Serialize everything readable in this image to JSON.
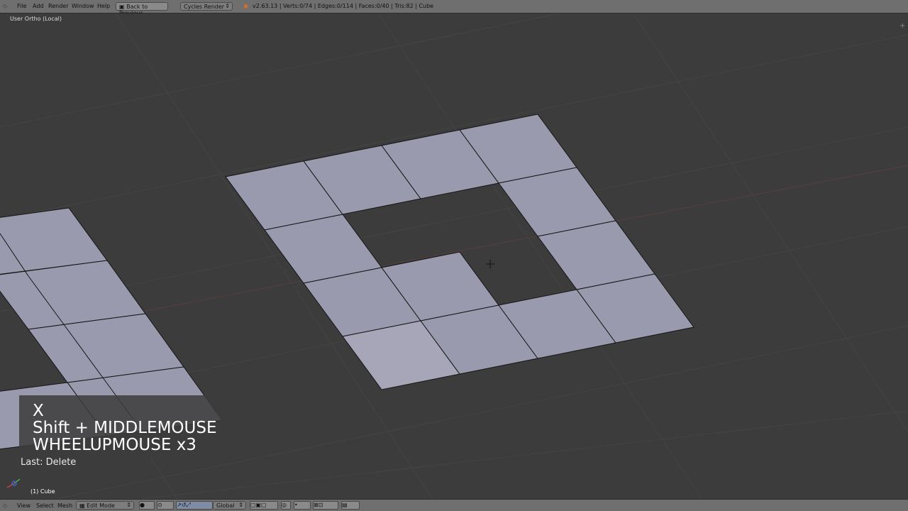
{
  "topbar": {
    "menu": [
      "File",
      "Add",
      "Render",
      "Window",
      "Help"
    ],
    "back_button": "Back to Previous",
    "engine": "Cycles Render",
    "stats": "v2.63.13 | Verts:0/74 | Edges:0/114 | Faces:0/40 | Tris:82 | Cube"
  },
  "viewport": {
    "view_name": "User Ortho (Local)",
    "keys": [
      "X",
      "Shift + MIDDLEMOUSE",
      "WHEELUPMOUSE x3"
    ],
    "last_operation": "Last: Delete",
    "object_name": "(1) Cube"
  },
  "bottombar": {
    "menu": [
      "View",
      "Select",
      "Mesh"
    ],
    "mode": "Edit Mode",
    "orientation": "Global"
  },
  "colors": {
    "face": "#9a9aae",
    "edge": "#141414",
    "background": "#3c3c3c",
    "grid": "#444444",
    "header": "#6f6f6f"
  }
}
